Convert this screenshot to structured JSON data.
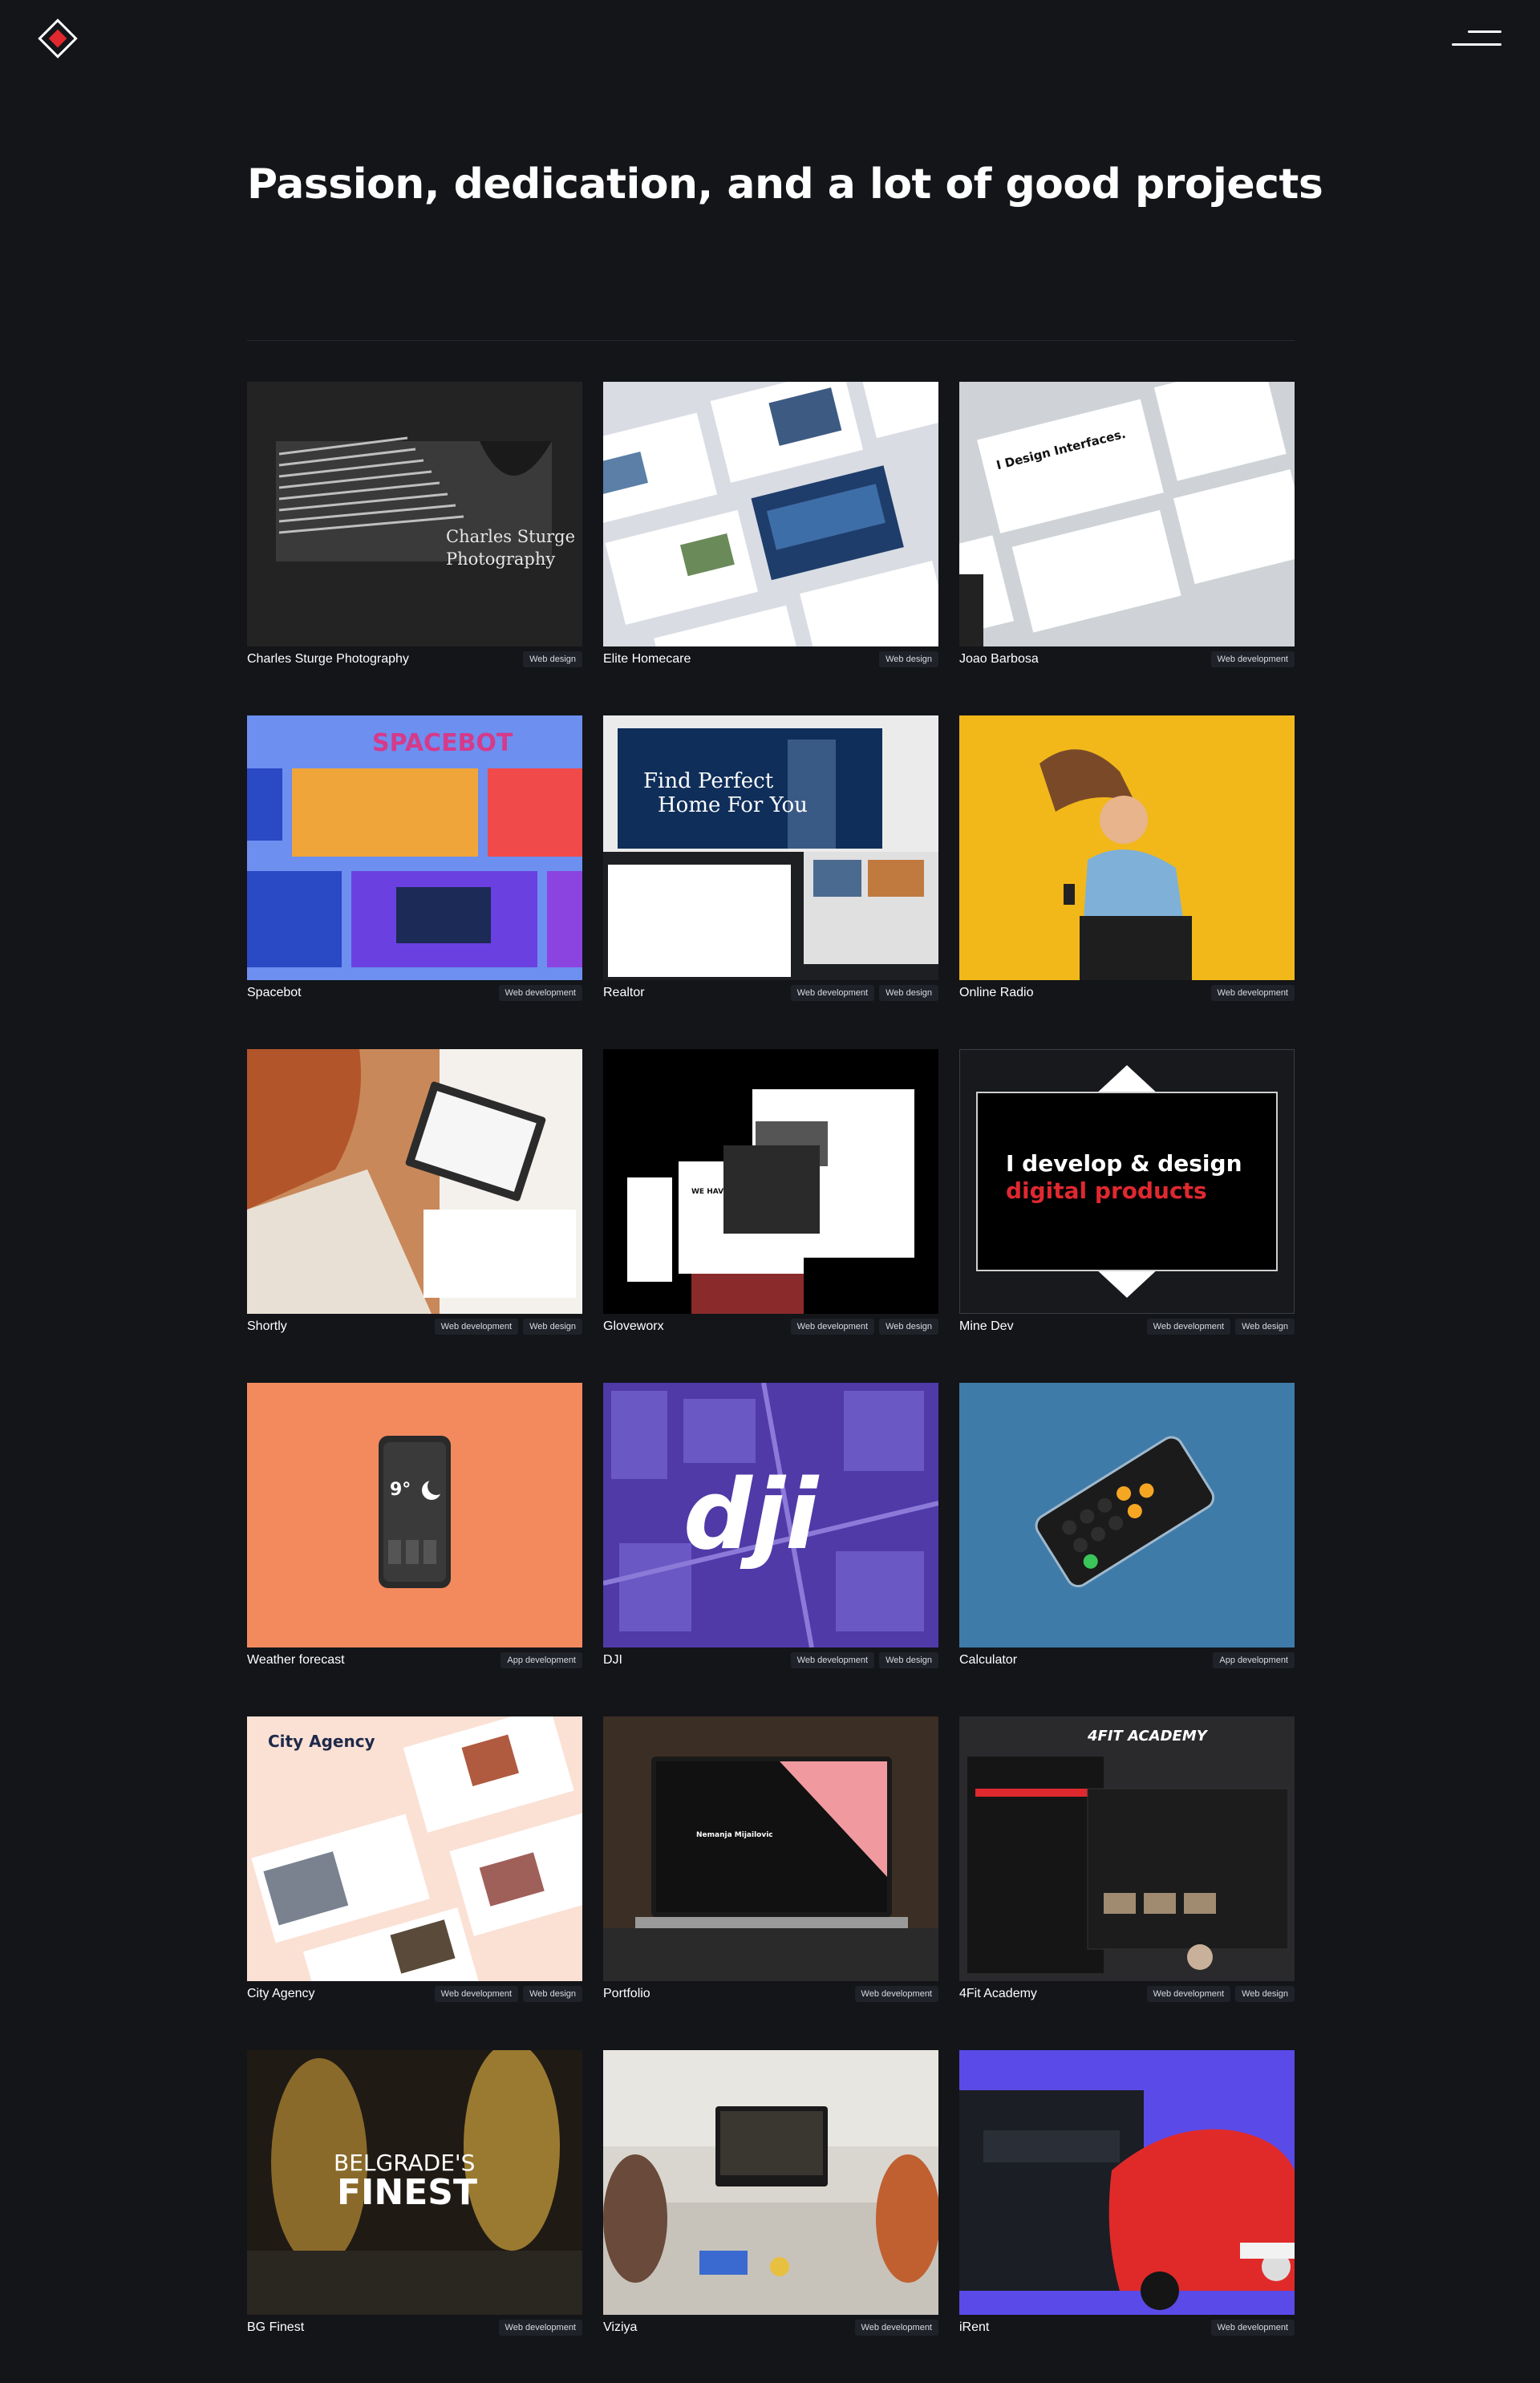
{
  "header": {
    "logo_icon": "diamond-logo-icon",
    "menu_icon": "hamburger-menu-icon"
  },
  "title": "Passion, dedication, and a lot of good projects",
  "colors": {
    "background": "#131519",
    "accent": "#e0282f",
    "tag_bg": "#1f2228"
  },
  "projects": [
    {
      "name": "Charles Sturge Photography",
      "tags": [
        "Web design"
      ],
      "thumb_text": "Charles Sturge\nPhotography"
    },
    {
      "name": "Elite Homecare",
      "tags": [
        "Web design"
      ]
    },
    {
      "name": "Joao Barbosa",
      "tags": [
        "Web development"
      ],
      "thumb_text": "I Design Interfaces."
    },
    {
      "name": "Spacebot",
      "tags": [
        "Web development"
      ],
      "thumb_text": "SPACEBOT"
    },
    {
      "name": "Realtor",
      "tags": [
        "Web development",
        "Web design"
      ],
      "thumb_text": "Find Perfect Home For You"
    },
    {
      "name": "Online Radio",
      "tags": [
        "Web development"
      ]
    },
    {
      "name": "Shortly",
      "tags": [
        "Web development",
        "Web design"
      ]
    },
    {
      "name": "Gloveworx",
      "tags": [
        "Web development",
        "Web design"
      ],
      "thumb_text": "WE HAVE BOXING FOR EVERYONE"
    },
    {
      "name": "Mine Dev",
      "tags": [
        "Web development",
        "Web design"
      ],
      "thumb_text": "I develop & design",
      "thumb_text2": "digital products"
    },
    {
      "name": "Weather forecast",
      "tags": [
        "App development"
      ],
      "thumb_text": "9°"
    },
    {
      "name": "DJI",
      "tags": [
        "Web development",
        "Web design"
      ],
      "thumb_text": "dji"
    },
    {
      "name": "Calculator",
      "tags": [
        "App development"
      ]
    },
    {
      "name": "City Agency",
      "tags": [
        "Web development",
        "Web design"
      ],
      "thumb_text": "City Agency"
    },
    {
      "name": "Portfolio",
      "tags": [
        "Web development"
      ],
      "thumb_text": "Nemanja Mijailovic"
    },
    {
      "name": "4Fit Academy",
      "tags": [
        "Web development",
        "Web design"
      ],
      "thumb_text": "4FIT ACADEMY"
    },
    {
      "name": "BG Finest",
      "tags": [
        "Web development"
      ],
      "thumb_text": "BELGRADE'S",
      "thumb_text2": "FINEST"
    },
    {
      "name": "Viziya",
      "tags": [
        "Web development"
      ]
    },
    {
      "name": "iRent",
      "tags": [
        "Web development"
      ]
    }
  ]
}
